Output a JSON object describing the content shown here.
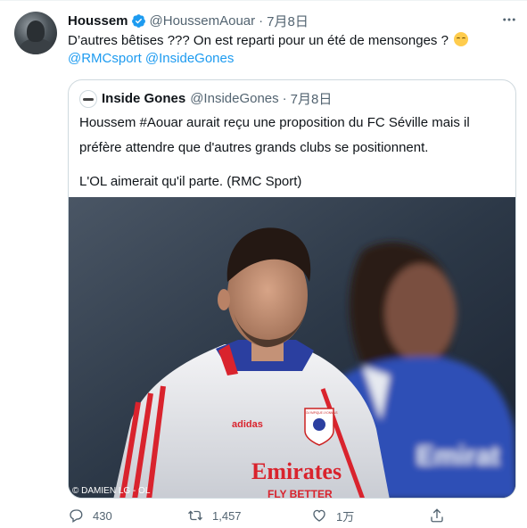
{
  "tweet": {
    "author_name": "Houssem",
    "handle": "@HoussemAouar",
    "separator": "·",
    "date": "7月8日",
    "text_line1": "D’autres bêtises ??? On est reparti pour un été de mensonges ?",
    "emoji": "pensive-face",
    "mention1": "@RMCsport",
    "mention2": "@InsideGones"
  },
  "quoted": {
    "author_name": "Inside Gones",
    "handle": "@InsideGones",
    "separator": "·",
    "date": "7月8日",
    "line1": "Houssem #Aouar aurait reçu une proposition du FC Séville mais il",
    "line2": "préfère attendre que d'autres grands clubs se positionnent.",
    "line3": "L'OL aimerait qu'il parte. (RMC Sport)",
    "media": {
      "photo_credit": "© DAMIEN LG - OL",
      "sponsor_text": "Emirates",
      "sponsor_sub": "FLY BETTER",
      "brand_text": "adidas",
      "crest_text": "OLYMPIQUE LYONNAIS",
      "background_shirt_text": "Emirat"
    }
  },
  "actions": {
    "reply_count": "430",
    "retweet_count": "1,457",
    "like_count": "1万"
  },
  "colors": {
    "accent": "#1d9bf0",
    "secondary_text": "#536471",
    "border": "#cfd9de"
  }
}
